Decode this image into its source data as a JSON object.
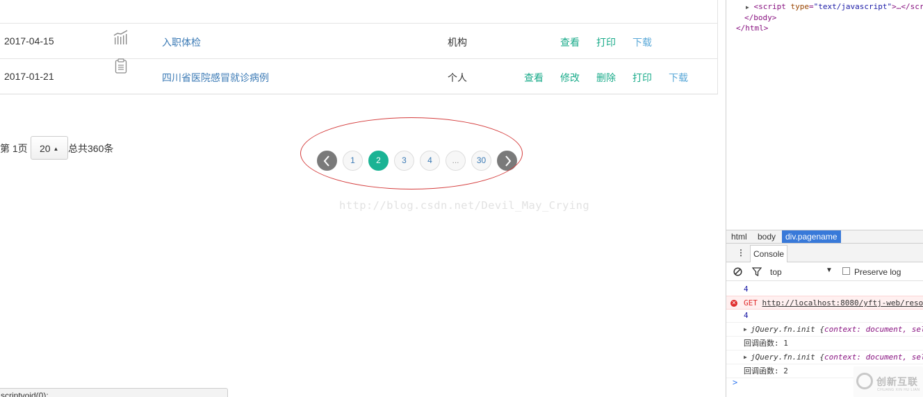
{
  "table": {
    "rows": [
      {
        "date": "2017-04-15",
        "icon": "bar-chart-icon",
        "name": "入职体检",
        "type": "机构",
        "actions": [
          "查看",
          "打印",
          "下载"
        ]
      },
      {
        "date": "2017-01-21",
        "icon": "clipboard-icon",
        "name": "四川省医院感冒就诊病例",
        "type": "个人",
        "actions": [
          "查看",
          "修改",
          "删除",
          "打印",
          "下载"
        ]
      }
    ]
  },
  "pager": {
    "prefix": "第 1页",
    "page_size": "20",
    "suffix": "总共360条",
    "pages": [
      "1",
      "2",
      "3",
      "4",
      "...",
      "30"
    ],
    "current": "2"
  },
  "watermark": "http://blog.csdn.net/Devil_May_Crying",
  "status_bar": "scriptvoid(0);",
  "devtools": {
    "elements": {
      "script_tag": "script",
      "script_attr": "type",
      "script_val": "\"text/javascript\"",
      "script_tail": ">…</scri",
      "body_close": "</body>",
      "html_close": "</html>"
    },
    "breadcrumbs": [
      "html",
      "body",
      "div.pagename"
    ],
    "console_tab": "Console",
    "context": "top",
    "preserve_log": "Preserve log",
    "logs": [
      {
        "kind": "num",
        "text": "4"
      },
      {
        "kind": "err",
        "method": "GET",
        "url": "http://localhost:8080/yftj-web/reso"
      },
      {
        "kind": "num",
        "text": "4"
      },
      {
        "kind": "obj",
        "text": "jQuery.fn.init {",
        "k1": "context",
        "v1": ": document, sel"
      },
      {
        "kind": "cn",
        "text": "回调函数: 1"
      },
      {
        "kind": "obj",
        "text": "jQuery.fn.init {",
        "k1": "context",
        "v1": ": document, sel"
      },
      {
        "kind": "cn",
        "text": "回调函数: 2"
      }
    ],
    "prompt": ">"
  },
  "logo": {
    "title": "创新互联",
    "subtitle": "CHUANG XIN HU LIAN"
  },
  "colors": {
    "accent": "#1ab394",
    "link": "#3b7ab5",
    "annotation": "#d43b3b",
    "devtools_selected": "#3879d9"
  }
}
